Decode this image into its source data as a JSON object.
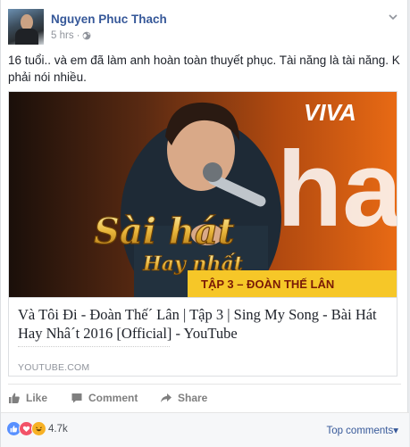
{
  "post": {
    "author": "Nguyen Phuc Thach",
    "time": "5 hrs",
    "separator": "·",
    "text": "16 tuổi.. và em đã làm anh hoàn toàn thuyết phục. Tài năng là tài năng. K phải nói nhiều."
  },
  "link": {
    "title": "Và Tôi Đi - Đoàn Thế´ Lân | Tập 3 | Sing My Song - Bài Hát Hay Nhâ´t 2016 [Official] - YouTube",
    "domain": "YOUTUBE.COM",
    "image": {
      "brand": "VIVA",
      "show_line1": "Sài hát",
      "show_line2": "Hay nhất",
      "banner": "TẬP 3 – ĐOÀN THẾ LÂN",
      "big_text": "ha"
    }
  },
  "actions": {
    "like": "Like",
    "comment": "Comment",
    "share": "Share"
  },
  "reactions": {
    "count": "4.7k",
    "top_comments": "Top comments",
    "top_comments_arrow": "▾",
    "icons": [
      "like-reaction-icon",
      "love-reaction-icon",
      "haha-reaction-icon"
    ]
  },
  "colors": {
    "link_blue": "#365899",
    "like_blue": "#5890ff",
    "love_red": "#f25268",
    "haha_yellow": "#f7b125"
  }
}
